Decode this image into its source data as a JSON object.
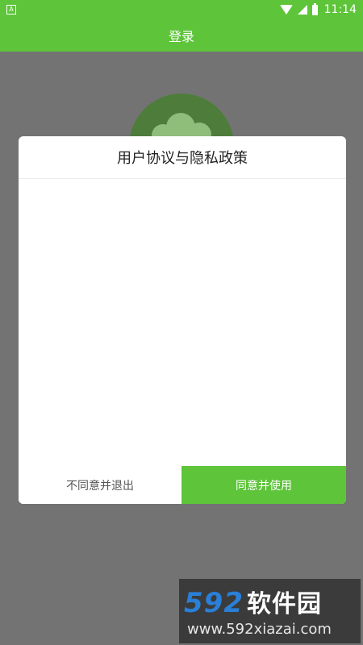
{
  "status_bar": {
    "left_icon": "A",
    "time": "11:14",
    "icons": [
      "wifi-icon",
      "signal-icon",
      "battery-icon"
    ]
  },
  "app_bar": {
    "title": "登录"
  },
  "dialog": {
    "title": "用户协议与隐私政策",
    "decline_label": "不同意并退出",
    "accept_label": "同意并使用"
  },
  "watermark": {
    "brand_number": "592",
    "brand_name": "软件园",
    "url": "www.592xiazai.com"
  },
  "colors": {
    "accent": "#5ec43a",
    "overlay": "#737373"
  }
}
